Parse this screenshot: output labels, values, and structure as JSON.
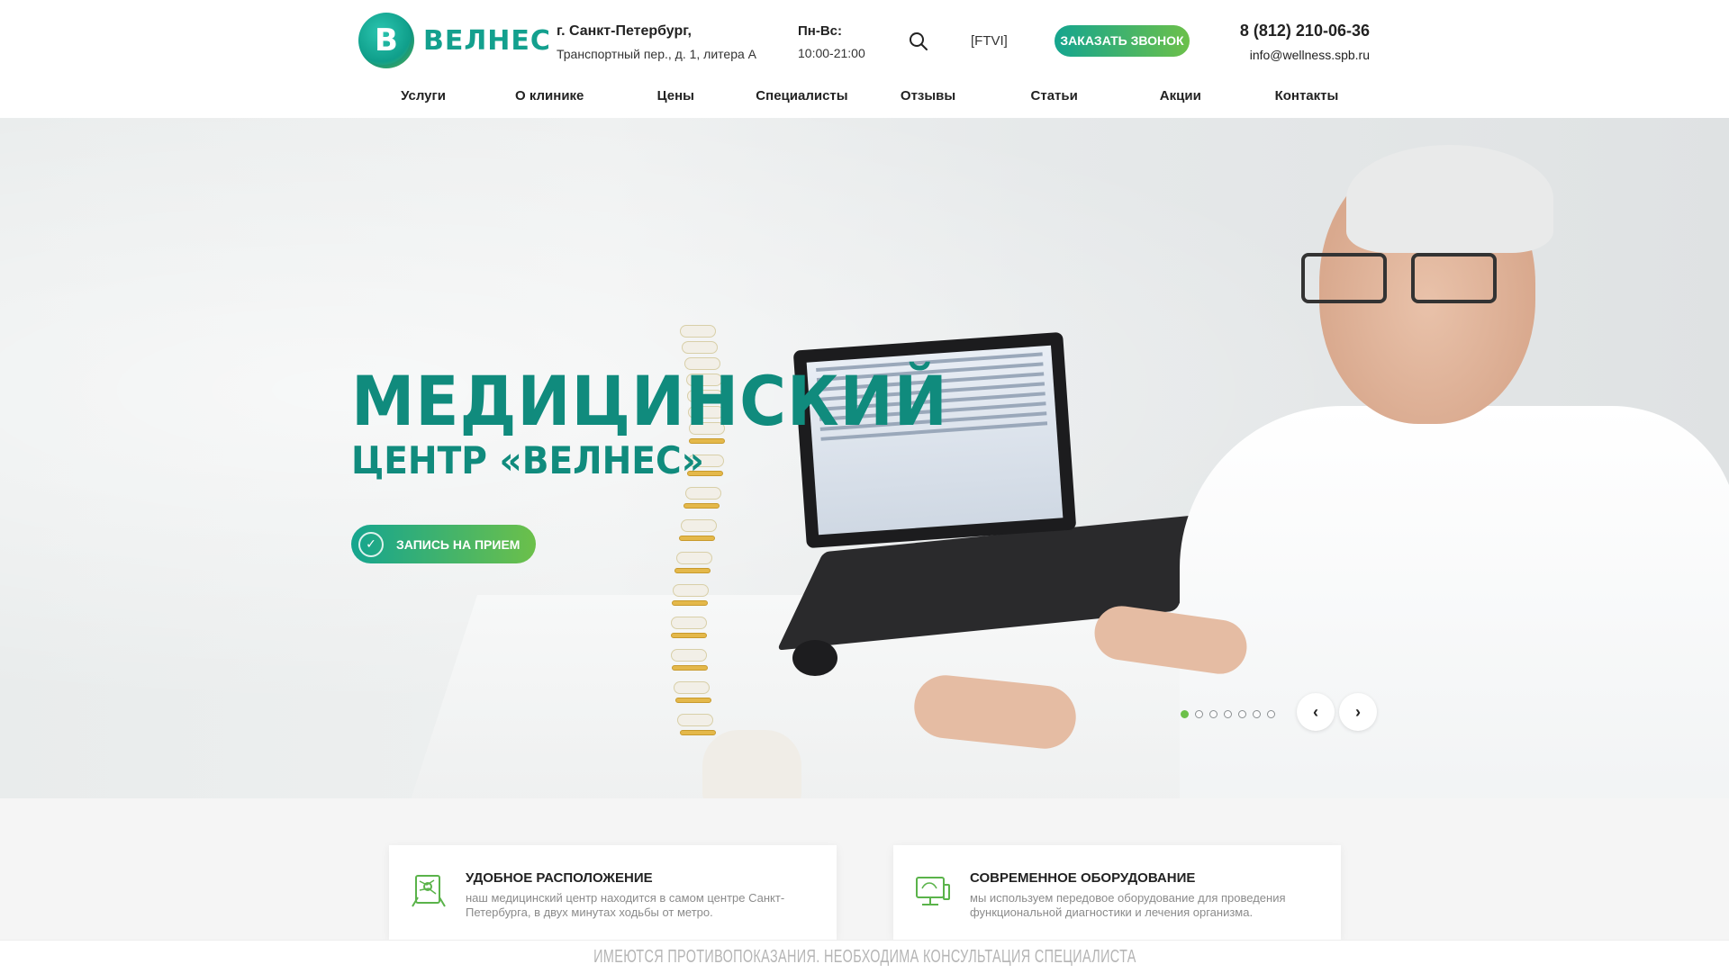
{
  "header": {
    "logo_letter": "В",
    "logo_text": "ВЕЛНЕС",
    "city": "г. Санкт-Петербург,",
    "street": "Транспортный пер., д. 1, литера А",
    "days": "Пн-Вс:",
    "time": "10:00-21:00",
    "search_icon": "search-icon",
    "lang": "[FTVI]",
    "callback_label": "ЗАКАЗАТЬ ЗВОНОК",
    "phone": "8 (812) 210-06-36",
    "email": "info@wellness.spb.ru"
  },
  "nav": {
    "items": [
      {
        "label": "Услуги"
      },
      {
        "label": "О клинике"
      },
      {
        "label": "Цены"
      },
      {
        "label": "Специалисты"
      },
      {
        "label": "Отзывы"
      },
      {
        "label": "Статьи"
      },
      {
        "label": "Акции"
      },
      {
        "label": "Контакты"
      }
    ]
  },
  "hero": {
    "title_line1": "МЕДИЦИНСКИЙ",
    "title_line2": "ЦЕНТР «ВЕЛНЕС»",
    "appointment_label": "ЗАПИСЬ НА ПРИЕМ",
    "slides_count": 7,
    "active_slide": 1,
    "prev_glyph": "‹",
    "next_glyph": "›"
  },
  "features": {
    "cards": [
      {
        "icon": "location-map-icon",
        "title": "УДОБНОЕ РАСПОЛОЖЕНИЕ",
        "text": "наш медицинский центр находится в самом центре Санкт-Петербурга, в двух минутах ходьбы от метро."
      },
      {
        "icon": "equipment-monitor-icon",
        "title": "СОВРЕМЕННОЕ ОБОРУДОВАНИЕ",
        "text": "мы используем передовое оборудование для проведения функциональной диагностики и лечения организма."
      }
    ]
  },
  "disclaimer": "ИМЕЮТСЯ ПРОТИВОПОКАЗАНИЯ. НЕОБХОДИМА КОНСУЛЬТАЦИЯ СПЕЦИАЛИСТА",
  "colors": {
    "brand_teal": "#108b7d",
    "gradient_start": "#15a58f",
    "gradient_end": "#6cc04a"
  }
}
